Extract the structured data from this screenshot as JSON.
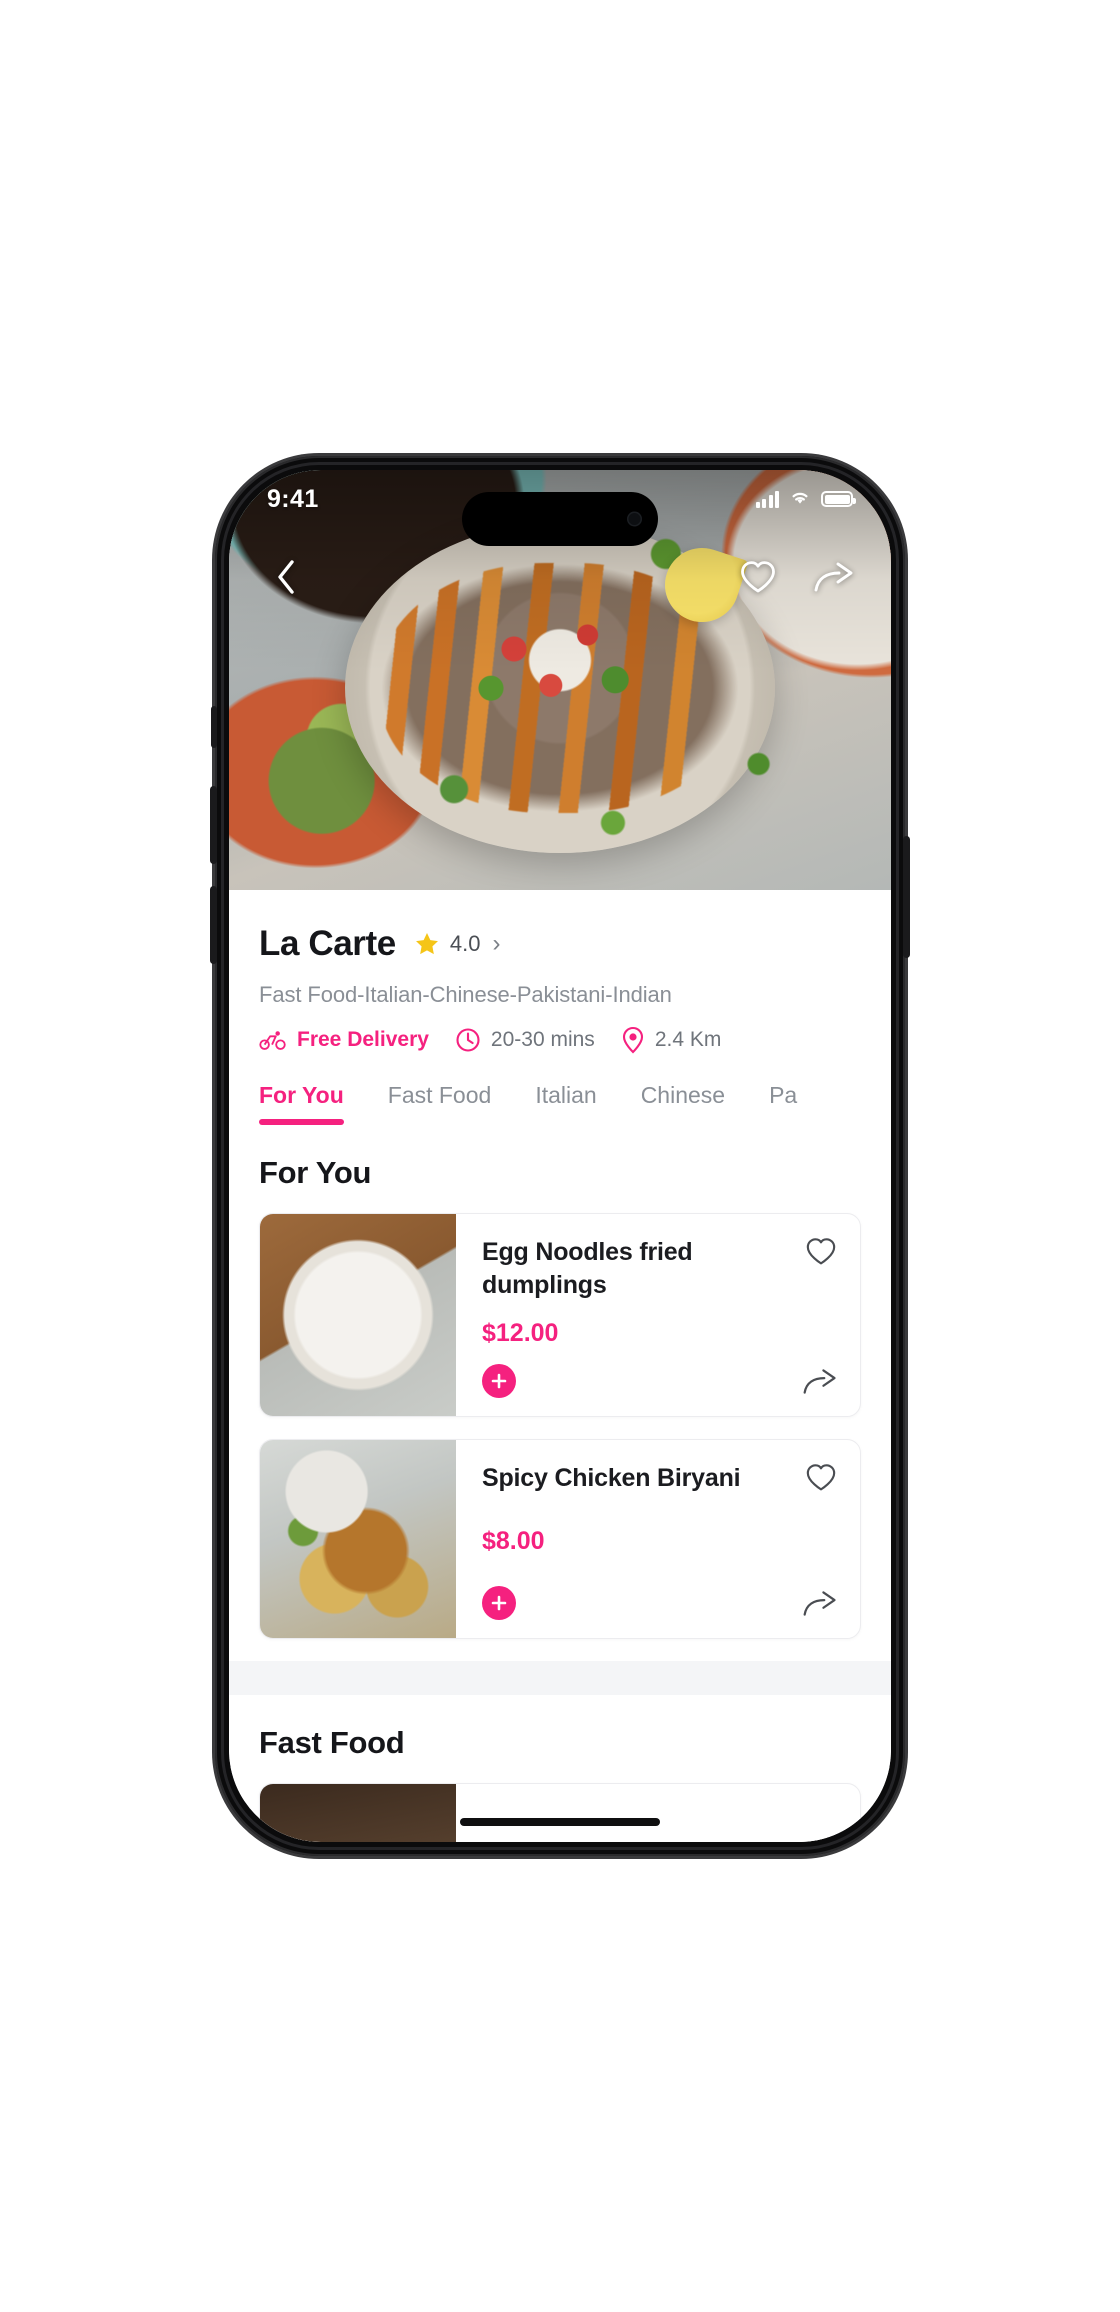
{
  "status_bar": {
    "time": "9:41",
    "signal_icon": "cellular-signal-icon",
    "wifi_icon": "wifi-icon",
    "battery_icon": "battery-icon"
  },
  "hero": {
    "back_icon": "chevron-left-icon",
    "favorite_icon": "heart-icon",
    "share_icon": "share-arrow-icon",
    "alt": "restaurant-hero-photo"
  },
  "restaurant": {
    "name": "La Carte",
    "rating": "4.0",
    "rating_star_icon": "star-icon",
    "rating_chevron": "›",
    "cuisines": "Fast Food-Italian-Chinese-Pakistani-Indian",
    "meta": [
      {
        "icon": "bicycle-icon",
        "text": "Free Delivery",
        "accent": true
      },
      {
        "icon": "clock-icon",
        "text": "20-30 mins",
        "accent": false
      },
      {
        "icon": "location-pin-icon",
        "text": "2.4 Km",
        "accent": false
      }
    ]
  },
  "tabs": [
    {
      "label": "For You",
      "active": true
    },
    {
      "label": "Fast Food",
      "active": false
    },
    {
      "label": "Italian",
      "active": false
    },
    {
      "label": "Chinese",
      "active": false
    },
    {
      "label": "Pa",
      "active": false
    }
  ],
  "sections": [
    {
      "title": "For You",
      "items": [
        {
          "name": "Egg Noodles fried dumplings",
          "price": "$12.00",
          "image": "img-noodles",
          "favorite_icon": "heart-icon",
          "add_icon": "plus-icon",
          "share_icon": "share-arrow-icon"
        },
        {
          "name": "Spicy Chicken Biryani",
          "price": "$8.00",
          "image": "img-biryani",
          "favorite_icon": "heart-icon",
          "add_icon": "plus-icon",
          "share_icon": "share-arrow-icon"
        }
      ]
    },
    {
      "title": "Fast Food",
      "items": [
        {
          "name": "",
          "price": "",
          "image": "img-burger",
          "favorite_icon": "heart-icon",
          "add_icon": "plus-icon",
          "share_icon": "share-arrow-icon"
        }
      ]
    }
  ],
  "colors": {
    "accent": "#f5217f",
    "text_primary": "#15161a",
    "text_secondary": "#8a8f96",
    "star": "#f5c518",
    "card_border": "#ececef",
    "section_gap": "#f4f5f7"
  }
}
